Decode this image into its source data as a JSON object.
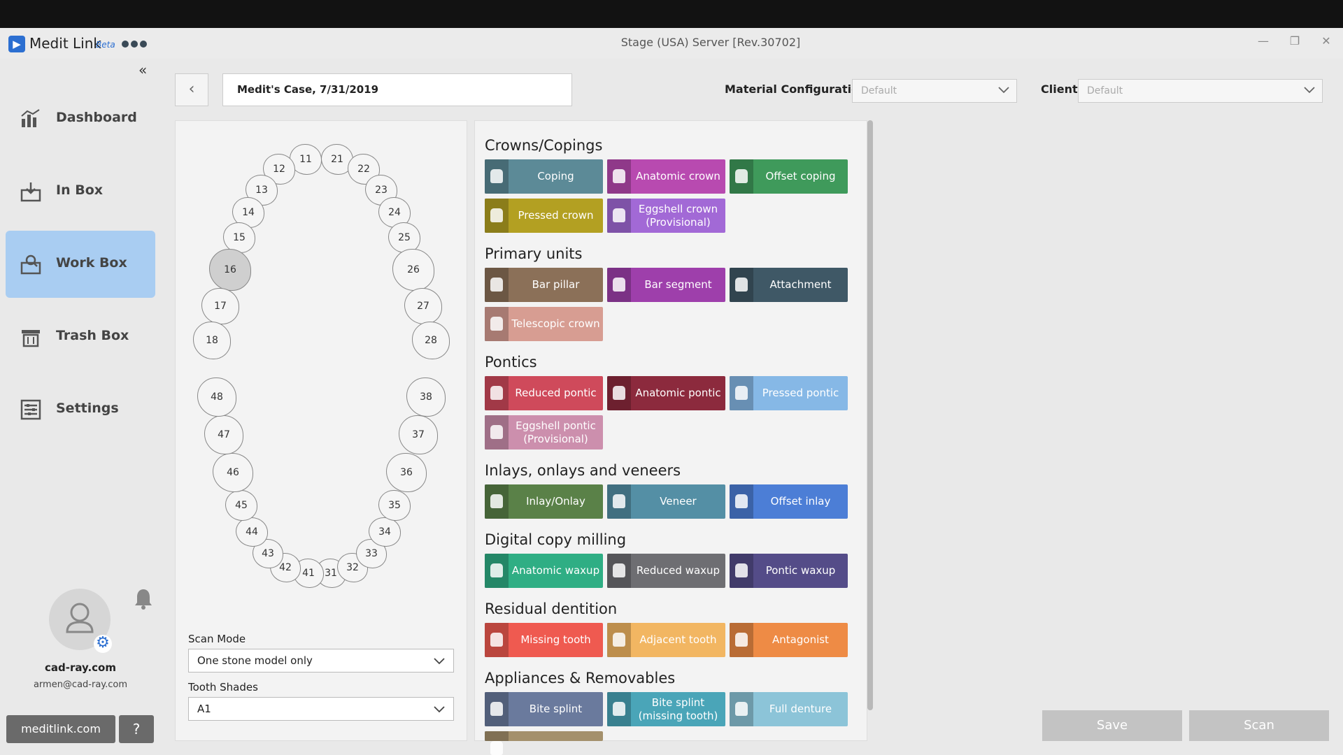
{
  "app": {
    "name": "Medit Link",
    "badge": "Beta",
    "logo_glyph": "▶",
    "server_title": "Stage (USA) Server [Rev.30702]"
  },
  "window": {
    "minimize": "—",
    "restore": "❐",
    "close": "✕"
  },
  "sidebar": {
    "collapse": "«",
    "items": [
      {
        "label": "Dashboard",
        "icon": "dashboard-icon"
      },
      {
        "label": "In Box",
        "icon": "inbox-icon"
      },
      {
        "label": "Work Box",
        "icon": "workbox-icon",
        "active": true
      },
      {
        "label": "Trash Box",
        "icon": "trash-icon"
      },
      {
        "label": "Settings",
        "icon": "settings-icon"
      }
    ],
    "user": {
      "name": "cad-ray.com",
      "email": "armen@cad-ray.com"
    },
    "website_button": "meditlink.com",
    "help_icon": "?",
    "gear_glyph": "⚙",
    "bell_glyph": "🔔"
  },
  "header": {
    "back": "‹",
    "case_name": "Medit's Case, 7/31/2019",
    "material_label": "Material Configuration",
    "material_value": "Default",
    "client_label": "Client",
    "client_value": "Default"
  },
  "teeth": [
    "11",
    "12",
    "13",
    "14",
    "15",
    "16",
    "17",
    "18",
    "21",
    "22",
    "23",
    "24",
    "25",
    "26",
    "27",
    "28",
    "31",
    "32",
    "33",
    "34",
    "35",
    "36",
    "37",
    "38",
    "41",
    "42",
    "43",
    "44",
    "45",
    "46",
    "47",
    "48"
  ],
  "form": {
    "scan_mode_label": "Scan Mode",
    "scan_mode_value": "One stone model only",
    "shade_label": "Tooth Shades",
    "shade_value": "A1"
  },
  "sections": [
    {
      "title": "Crowns/Copings",
      "items": [
        {
          "label": "Coping",
          "color": "#5c8a97"
        },
        {
          "label": "Anatomic crown",
          "color": "#b84ab0"
        },
        {
          "label": "Offset coping",
          "color": "#3f9a5b"
        },
        {
          "label": "Pressed crown",
          "color": "#b3a022"
        },
        {
          "label": "Eggshell crown (Provisional)",
          "color": "#a269d6"
        }
      ]
    },
    {
      "title": "Primary units",
      "items": [
        {
          "label": "Bar pillar",
          "color": "#8b7058"
        },
        {
          "label": "Bar segment",
          "color": "#9e3fab"
        },
        {
          "label": "Attachment",
          "color": "#3f5866"
        },
        {
          "label": "Telescopic crown",
          "color": "#d79d92"
        }
      ]
    },
    {
      "title": "Pontics",
      "items": [
        {
          "label": "Reduced pontic",
          "color": "#cf4a5b"
        },
        {
          "label": "Anatomic pontic",
          "color": "#8c2a3d"
        },
        {
          "label": "Pressed pontic",
          "color": "#86b8e6"
        },
        {
          "label": "Eggshell pontic (Provisional)",
          "color": "#cc8fad"
        }
      ]
    },
    {
      "title": "Inlays, onlays and veneers",
      "items": [
        {
          "label": "Inlay/Onlay",
          "color": "#5a8148"
        },
        {
          "label": "Veneer",
          "color": "#548fa5"
        },
        {
          "label": "Offset inlay",
          "color": "#4c7ed6"
        }
      ]
    },
    {
      "title": "Digital copy milling",
      "items": [
        {
          "label": "Anatomic waxup",
          "color": "#2fae84"
        },
        {
          "label": "Reduced waxup",
          "color": "#6e6e72"
        },
        {
          "label": "Pontic waxup",
          "color": "#544c88"
        }
      ]
    },
    {
      "title": "Residual dentition",
      "items": [
        {
          "label": "Missing tooth",
          "color": "#ef5a50"
        },
        {
          "label": "Adjacent tooth",
          "color": "#f2b662"
        },
        {
          "label": "Antagonist",
          "color": "#ee8b45"
        }
      ]
    },
    {
      "title": "Appliances & Removables",
      "items": [
        {
          "label": "Bite splint",
          "color": "#6a7a9d"
        },
        {
          "label": "Bite splint (missing tooth)",
          "color": "#4aa5b8"
        },
        {
          "label": "Full denture",
          "color": "#8cc4d8"
        },
        {
          "label": "",
          "color": "#a4906c"
        }
      ]
    }
  ],
  "actions": {
    "save": "Save",
    "scan": "Scan"
  }
}
